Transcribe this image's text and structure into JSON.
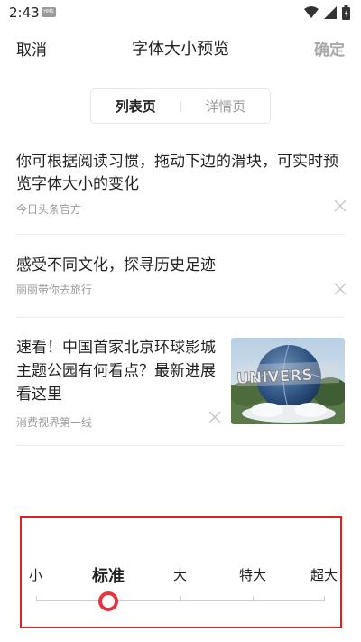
{
  "status_bar": {
    "time": "2:43",
    "badge": "HMS"
  },
  "header": {
    "cancel_label": "取消",
    "title": "字体大小预览",
    "confirm_label": "确定"
  },
  "tabs": [
    {
      "label": "列表页",
      "active": true
    },
    {
      "label": "详情页",
      "active": false
    }
  ],
  "news": [
    {
      "title": "你可根据阅读习惯，拖动下边的滑块，可实时预览字体大小的变化",
      "source": "今日头条官方"
    },
    {
      "title": "感受不同文化，探寻历史足迹",
      "source": "丽丽带你去旅行"
    },
    {
      "title": "速看！中国首家北京环球影城主题公园有何看点？最新进展看这里",
      "source": "消费视界第一线"
    }
  ],
  "font_size": {
    "options": [
      "小",
      "标准",
      "大",
      "特大",
      "超大"
    ],
    "selected": "标准"
  },
  "colors": {
    "accent": "#e8343f",
    "highlight_border": "#e02020"
  },
  "icons": [
    "wifi-icon",
    "cellular-icon",
    "battery-icon",
    "close-icon"
  ]
}
